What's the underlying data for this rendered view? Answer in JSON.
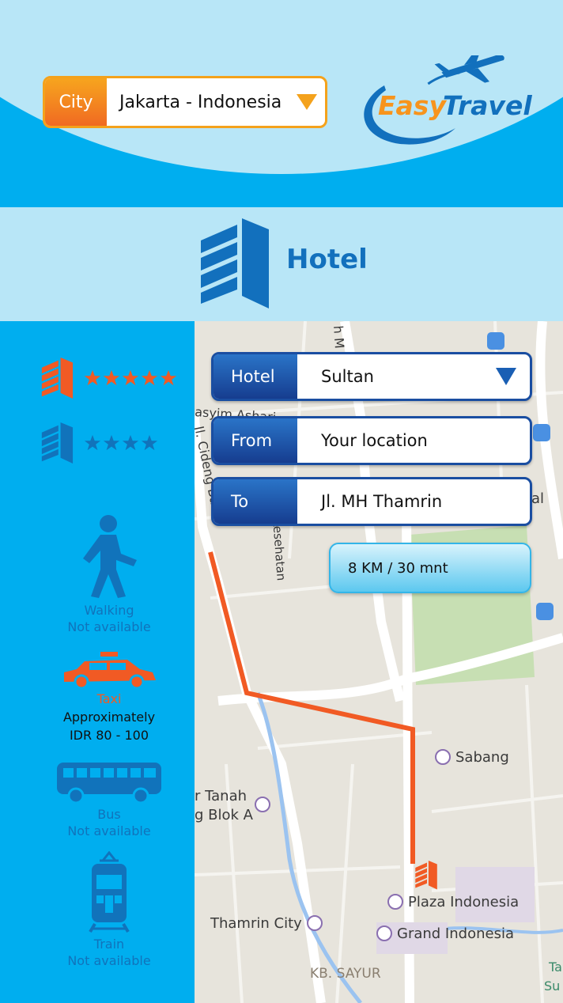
{
  "header": {
    "city_label": "City",
    "city_value": "Jakarta - Indonesia",
    "logo_easy": "Easy",
    "logo_travel": "Travel"
  },
  "banner": {
    "title": "Hotel"
  },
  "sidebar": {
    "ratings": [
      {
        "stars": 5,
        "color": "#f15a24"
      },
      {
        "stars": 4,
        "color": "#1173bb"
      }
    ],
    "modes": [
      {
        "name": "Walking",
        "status": "Not available"
      },
      {
        "name": "Taxi",
        "status_line1": "Approximately",
        "status_line2": "IDR 80 - 100"
      },
      {
        "name": "Bus",
        "status": "Not available"
      },
      {
        "name": "Train",
        "status": "Not available"
      }
    ]
  },
  "form": {
    "hotel": {
      "label": "Hotel",
      "value": "Sultan"
    },
    "from": {
      "label": "From",
      "value": "Your location"
    },
    "to": {
      "label": "To",
      "value": "Jl. MH Thamrin"
    },
    "distance": "8 KM / 30 mnt"
  },
  "map": {
    "streets": {
      "mh": "h M",
      "asyim": "asyim Ashari",
      "cideng": "Jl. Cideng Barat",
      "kesehatan": "Jl. Kesehatan",
      "tanah": "r Tanah",
      "blok": "g Blok A"
    },
    "places": {
      "sabang": "Sabang",
      "plaza": "Plaza Indonesia",
      "grand": "Grand Indonesia",
      "thamrin_city": "Thamrin City",
      "kb_sayur": "KB. SAYUR",
      "al": "al",
      "ta": "Ta",
      "su": "Su"
    }
  },
  "colors": {
    "sky": "#b8e6f7",
    "blue": "#00aeef",
    "dark_blue": "#1270bd",
    "orange": "#f15a24",
    "route": "#f15a24"
  }
}
